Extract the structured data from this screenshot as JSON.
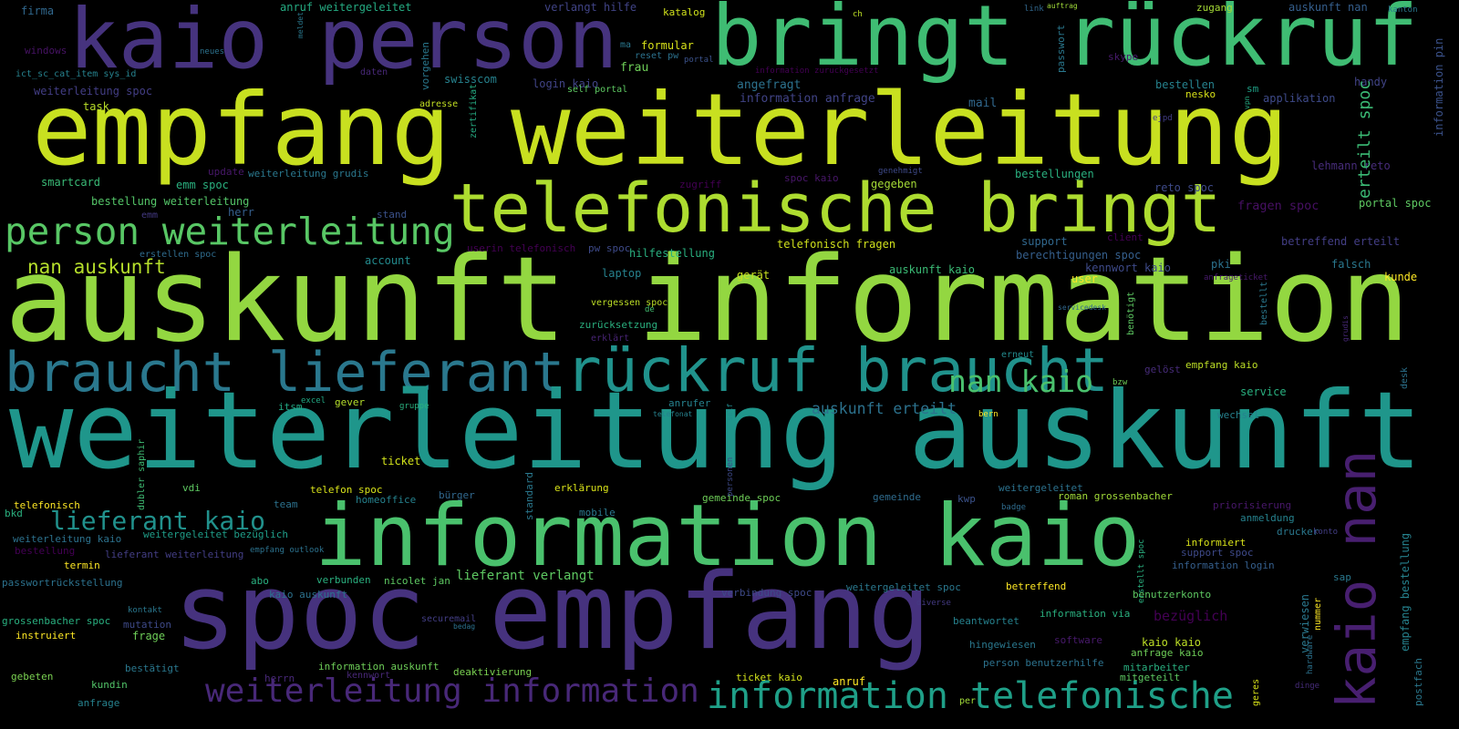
{
  "words": [
    {
      "text": "kaio person",
      "color": "#46337e"
    },
    {
      "text": "bringt rückruf",
      "color": "#3fbc73"
    },
    {
      "text": "empfang weiterleitung",
      "color": "#c8e020"
    },
    {
      "text": "telefonische bringt",
      "color": "#addc30"
    },
    {
      "text": "person weiterleitung",
      "color": "#58c765"
    },
    {
      "text": "auskunft information",
      "color": "#93d741"
    },
    {
      "text": "braucht lieferant",
      "color": "#2a788e"
    },
    {
      "text": "rückruf braucht",
      "color": "#20928c"
    },
    {
      "text": "weiterleitung auskunft",
      "color": "#1f968b"
    },
    {
      "text": "information kaio",
      "color": "#4ac16d"
    },
    {
      "text": "spoc empfang",
      "color": "#46327e"
    },
    {
      "text": "weiterleitung information",
      "color": "#482878"
    },
    {
      "text": "information telefonische",
      "color": "#1fa088"
    },
    {
      "text": "nan kaio",
      "color": "#4ac16d"
    },
    {
      "text": "lieferant kaio",
      "color": "#21918c"
    },
    {
      "text": "nan auskunft",
      "color": "#b5de2b"
    },
    {
      "text": "auskunft erteilt",
      "color": "#2c728e"
    },
    {
      "text": "fragen spoc",
      "color": "#471063"
    },
    {
      "text": "bezüglich",
      "color": "#440154"
    },
    {
      "text": "lieferant verlangt",
      "color": "#5ec962"
    },
    {
      "text": "firma",
      "color": "#31688e"
    },
    {
      "text": "anruf weitergeleitet",
      "color": "#25ab82"
    },
    {
      "text": "verlangt hilfe",
      "color": "#414487"
    },
    {
      "text": "katalog",
      "color": "#d0e11c"
    },
    {
      "text": "ch",
      "color": "#bddf26"
    },
    {
      "text": "link",
      "color": "#31688e"
    },
    {
      "text": "auftrag",
      "color": "#a0da39"
    },
    {
      "text": "zugang",
      "color": "#a5db36"
    },
    {
      "text": "auskunft nan",
      "color": "#355f8d"
    },
    {
      "text": "kanton",
      "color": "#2a788e"
    },
    {
      "text": "windows",
      "color": "#471365"
    },
    {
      "text": "neues",
      "color": "#2c728e"
    },
    {
      "text": "ma",
      "color": "#2a788e"
    },
    {
      "text": "formular",
      "color": "#d8e219"
    },
    {
      "text": "reset pw",
      "color": "#2c728e"
    },
    {
      "text": "portal",
      "color": "#3b528b"
    },
    {
      "text": "frau",
      "color": "#6ece58"
    },
    {
      "text": "information zuruckgesetzt",
      "color": "#440154"
    },
    {
      "text": "skype",
      "color": "#481a6c"
    },
    {
      "text": "ict_sc_cat_item sys_id",
      "color": "#26828e"
    },
    {
      "text": "daten",
      "color": "#482878"
    },
    {
      "text": "swisscom",
      "color": "#26828e"
    },
    {
      "text": "login kaio",
      "color": "#414487"
    },
    {
      "text": "self portal",
      "color": "#5ec962"
    },
    {
      "text": "angefragt",
      "color": "#2c728e"
    },
    {
      "text": "information anfrage",
      "color": "#414487"
    },
    {
      "text": "mail",
      "color": "#31688e"
    },
    {
      "text": "weiterleitung spoc",
      "color": "#433e85"
    },
    {
      "text": "task",
      "color": "#b8de29"
    },
    {
      "text": "adresse",
      "color": "#c2df23"
    },
    {
      "text": "bestellen",
      "color": "#26828e"
    },
    {
      "text": "nesko",
      "color": "#d8e219"
    },
    {
      "text": "sm",
      "color": "#1fa187"
    },
    {
      "text": "applikation",
      "color": "#3e4a89"
    },
    {
      "text": "handy",
      "color": "#414487"
    },
    {
      "text": "ejpd",
      "color": "#433e85"
    },
    {
      "text": "lehmann reto",
      "color": "#472c7a"
    },
    {
      "text": "update",
      "color": "#48186a"
    },
    {
      "text": "weiterleitung grudis",
      "color": "#2a788e"
    },
    {
      "text": "smartcard",
      "color": "#3aba76"
    },
    {
      "text": "emm spoc",
      "color": "#2ab07f"
    },
    {
      "text": "bestellung weiterleitung",
      "color": "#54c568"
    },
    {
      "text": "herr",
      "color": "#355f8d"
    },
    {
      "text": "emm",
      "color": "#443a83"
    },
    {
      "text": "stand",
      "color": "#3b528b"
    },
    {
      "text": "genehmigt",
      "color": "#3e4a89"
    },
    {
      "text": "spoc kaio",
      "color": "#481769"
    },
    {
      "text": "zugriff",
      "color": "#440154"
    },
    {
      "text": "gegeben",
      "color": "#a5db36"
    },
    {
      "text": "bestellungen",
      "color": "#2ab07f"
    },
    {
      "text": "reto spoc",
      "color": "#3e4a89"
    },
    {
      "text": "portal spoc",
      "color": "#5ec962"
    },
    {
      "text": "erstellen spoc",
      "color": "#2f6c8e"
    },
    {
      "text": "userin telefonisch",
      "color": "#440154"
    },
    {
      "text": "pw spoc",
      "color": "#3e4a89"
    },
    {
      "text": "hilfestellung",
      "color": "#29af7f"
    },
    {
      "text": "telefonisch fragen",
      "color": "#d0e11c"
    },
    {
      "text": "support",
      "color": "#31688e"
    },
    {
      "text": "client",
      "color": "#440154"
    },
    {
      "text": "berechtigungen spoc",
      "color": "#355f8d"
    },
    {
      "text": "betreffend erteilt",
      "color": "#433e85"
    },
    {
      "text": "account",
      "color": "#238a8d"
    },
    {
      "text": "laptop",
      "color": "#26828e"
    },
    {
      "text": "gerät",
      "color": "#c8e020"
    },
    {
      "text": "auskunft kaio",
      "color": "#3bbb75"
    },
    {
      "text": "kennwort kaio",
      "color": "#3e4a89"
    },
    {
      "text": "pki",
      "color": "#2c728e"
    },
    {
      "text": "falsch",
      "color": "#2a788e"
    },
    {
      "text": "anfrageticket",
      "color": "#481a6c"
    },
    {
      "text": "user",
      "color": "#fde725"
    },
    {
      "text": "kunde",
      "color": "#fde725"
    },
    {
      "text": "vergessen spoc",
      "color": "#bddf26"
    },
    {
      "text": "de",
      "color": "#42be71"
    },
    {
      "text": "servicedesk",
      "color": "#31688e"
    },
    {
      "text": "zurücksetzung",
      "color": "#2ab07f"
    },
    {
      "text": "erklärt",
      "color": "#482475"
    },
    {
      "text": "erneut",
      "color": "#238a8d"
    },
    {
      "text": "empfang kaio",
      "color": "#bddf26"
    },
    {
      "text": "gelöst",
      "color": "#472c7a"
    },
    {
      "text": "bzw",
      "color": "#6ece58"
    },
    {
      "text": "service",
      "color": "#29af7f"
    },
    {
      "text": "excel",
      "color": "#22a884"
    },
    {
      "text": "gever",
      "color": "#b5de2b"
    },
    {
      "text": "itsm",
      "color": "#22a884"
    },
    {
      "text": "gruppe",
      "color": "#2ab07f"
    },
    {
      "text": "anrufer",
      "color": "#26828e"
    },
    {
      "text": "telefonat",
      "color": "#26828e"
    },
    {
      "text": "bern",
      "color": "#fde725"
    },
    {
      "text": "wechsel",
      "color": "#26828e"
    },
    {
      "text": "vdi",
      "color": "#5ec962"
    },
    {
      "text": "ticket",
      "color": "#d2e21b"
    },
    {
      "text": "weitergeleitet",
      "color": "#2c728e"
    },
    {
      "text": "telefonisch",
      "color": "#fde725"
    },
    {
      "text": "telefon spoc",
      "color": "#d8e219"
    },
    {
      "text": "erklärung",
      "color": "#d8e219"
    },
    {
      "text": "homeoffice",
      "color": "#26828e"
    },
    {
      "text": "bürger",
      "color": "#31688e"
    },
    {
      "text": "team",
      "color": "#2c728e"
    },
    {
      "text": "mobile",
      "color": "#2a788e"
    },
    {
      "text": "gemeinde spoc",
      "color": "#6ece58"
    },
    {
      "text": "gemeinde",
      "color": "#2f6c8e"
    },
    {
      "text": "roman grossenbacher",
      "color": "#a0da39"
    },
    {
      "text": "kwp",
      "color": "#3b528b"
    },
    {
      "text": "badge",
      "color": "#2f6c8e"
    },
    {
      "text": "priorisierung",
      "color": "#48186a"
    },
    {
      "text": "bkd",
      "color": "#2ab07f"
    },
    {
      "text": "anmeldung",
      "color": "#26828e"
    },
    {
      "text": "weiterleitung kaio",
      "color": "#2c728e"
    },
    {
      "text": "weitergeleitet bezüglich",
      "color": "#1f9e89"
    },
    {
      "text": "bestellung",
      "color": "#440154"
    },
    {
      "text": "lieferant weiterleitung",
      "color": "#433e85"
    },
    {
      "text": "empfang outlook",
      "color": "#2c728e"
    },
    {
      "text": "drucker",
      "color": "#2a788e"
    },
    {
      "text": "konto",
      "color": "#433e85"
    },
    {
      "text": "informiert",
      "color": "#d8e219"
    },
    {
      "text": "support spoc",
      "color": "#3e4a89"
    },
    {
      "text": "information login",
      "color": "#355f8d"
    },
    {
      "text": "termin",
      "color": "#fde725"
    },
    {
      "text": "passwortrückstellung",
      "color": "#2c728e"
    },
    {
      "text": "abo",
      "color": "#29af7f"
    },
    {
      "text": "verbunden",
      "color": "#2ab07f"
    },
    {
      "text": "nicolet jan",
      "color": "#5ec962"
    },
    {
      "text": "verbindung spoc",
      "color": "#3e4a89"
    },
    {
      "text": "weitergeleitet spoc",
      "color": "#2a788e"
    },
    {
      "text": "betreffend",
      "color": "#fde725"
    },
    {
      "text": "sap",
      "color": "#2a788e"
    },
    {
      "text": "benutzerkonto",
      "color": "#5ec962"
    },
    {
      "text": "kaio auskunft",
      "color": "#2c728e"
    },
    {
      "text": "kontakt",
      "color": "#2a788e"
    },
    {
      "text": "securemail",
      "color": "#433e85"
    },
    {
      "text": "diverse",
      "color": "#443a83"
    },
    {
      "text": "bedag",
      "color": "#2c728e"
    },
    {
      "text": "mutation",
      "color": "#3e4a89"
    },
    {
      "text": "information via",
      "color": "#2ab07f"
    },
    {
      "text": "grossenbacher spoc",
      "color": "#29af7f"
    },
    {
      "text": "beantwortet",
      "color": "#26828e"
    },
    {
      "text": "instruiert",
      "color": "#fde725"
    },
    {
      "text": "frage",
      "color": "#6ece58"
    },
    {
      "text": "software",
      "color": "#481a6c"
    },
    {
      "text": "hingewiesen",
      "color": "#2a788e"
    },
    {
      "text": "kaio kaio",
      "color": "#bddf26"
    },
    {
      "text": "anfrage kaio",
      "color": "#6ece58"
    },
    {
      "text": "bestätigt",
      "color": "#2a788e"
    },
    {
      "text": "person benutzerhilfe",
      "color": "#2c728e"
    },
    {
      "text": "information auskunft",
      "color": "#6ece58"
    },
    {
      "text": "deaktivierung",
      "color": "#7ad151"
    },
    {
      "text": "mitarbeiter",
      "color": "#29af7f"
    },
    {
      "text": "gebeten",
      "color": "#7ad151"
    },
    {
      "text": "ticket kaio",
      "color": "#d2e21b"
    },
    {
      "text": "mitgeteilt",
      "color": "#5ec962"
    },
    {
      "text": "anruf",
      "color": "#fde725"
    },
    {
      "text": "kennwort",
      "color": "#482878"
    },
    {
      "text": "herrn",
      "color": "#482878"
    },
    {
      "text": "kundin",
      "color": "#52c569"
    },
    {
      "text": "dinge",
      "color": "#472c7a"
    },
    {
      "text": "anfrage",
      "color": "#26828e"
    },
    {
      "text": "per",
      "color": "#a0da39"
    },
    {
      "text": "kaio nan",
      "color": "#481f70"
    },
    {
      "text": "erteilt spoc",
      "color": "#3bbb75"
    },
    {
      "text": "meldet",
      "color": "#2a788e"
    },
    {
      "text": "passwort",
      "color": "#2a788e"
    },
    {
      "text": "information pin",
      "color": "#3b528b"
    },
    {
      "text": "vorgehen",
      "color": "#2a788e"
    },
    {
      "text": "zertifikat",
      "color": "#25ab82"
    },
    {
      "text": "vpn",
      "color": "#25ab82"
    },
    {
      "text": "benötigt",
      "color": "#5ec962"
    },
    {
      "text": "bestellt",
      "color": "#2a788e"
    },
    {
      "text": "grudis",
      "color": "#482878"
    },
    {
      "text": "desk",
      "color": "#2c728e"
    },
    {
      "text": "self",
      "color": "#238a8d"
    },
    {
      "text": "dubler saphir",
      "color": "#3fbc73"
    },
    {
      "text": "personen",
      "color": "#3e4a89"
    },
    {
      "text": "standard",
      "color": "#2a788e"
    },
    {
      "text": "erstellt spoc",
      "color": "#29af7f"
    },
    {
      "text": "verwiesen",
      "color": "#2a788e"
    },
    {
      "text": "nummer",
      "color": "#fde725"
    },
    {
      "text": "empfang bestellung",
      "color": "#26828e"
    },
    {
      "text": "hardware",
      "color": "#2c728e"
    },
    {
      "text": "postfach",
      "color": "#2a788e"
    },
    {
      "text": "geres",
      "color": "#d8e219"
    }
  ]
}
